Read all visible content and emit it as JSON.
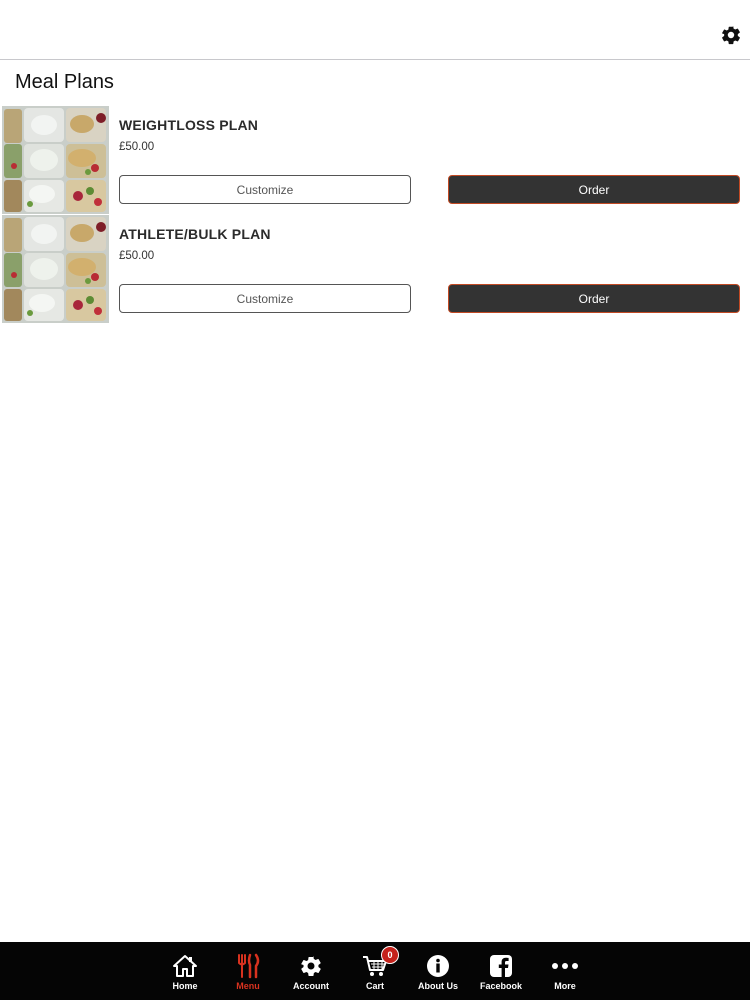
{
  "header": {
    "settings_icon": "gear-icon"
  },
  "page": {
    "title": "Meal Plans"
  },
  "plans": [
    {
      "name": "WEIGHTLOSS PLAN",
      "price": "£50.00",
      "customize_label": "Customize",
      "order_label": "Order"
    },
    {
      "name": "ATHLETE/BULK PLAN",
      "price": "£50.00",
      "customize_label": "Customize",
      "order_label": "Order"
    }
  ],
  "tabbar": {
    "items": [
      {
        "label": "Home",
        "icon": "home-icon"
      },
      {
        "label": "Menu",
        "icon": "fork-knife-icon",
        "active": true
      },
      {
        "label": "Account",
        "icon": "gear-icon"
      },
      {
        "label": "Cart",
        "icon": "cart-icon",
        "badge": "0"
      },
      {
        "label": "About Us",
        "icon": "info-icon"
      },
      {
        "label": "Facebook",
        "icon": "facebook-icon"
      },
      {
        "label": "More",
        "icon": "more-dots-icon"
      }
    ]
  },
  "colors": {
    "accent": "#d8321f",
    "order_button_bg": "#333333",
    "order_button_border": "#c24a24",
    "tabbar_bg": "#050505",
    "badge": "#c4221b"
  }
}
